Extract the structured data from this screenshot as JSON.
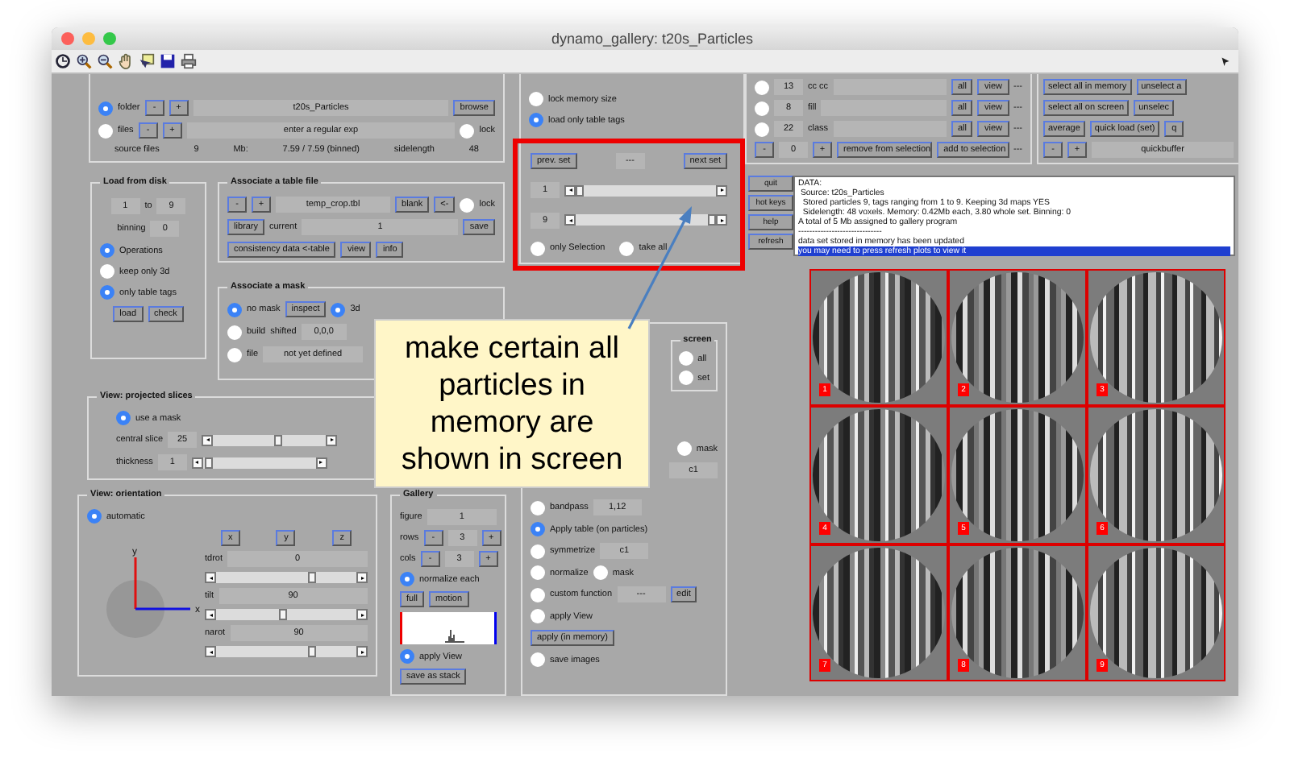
{
  "window": {
    "title": "dynamo_gallery: t20s_Particles"
  },
  "panels": [
    {
      "kind": "group",
      "rows": [
        {
          "items": [
            {
              "kind": "radio",
              "label": "folder",
              "selected": true
            },
            {
              "kind": "button",
              "label": "-"
            },
            {
              "kind": "button",
              "label": "+"
            },
            {
              "kind": "field",
              "value": "t20s_Particles"
            },
            {
              "kind": "button",
              "label": "browse"
            }
          ]
        },
        {
          "items": [
            {
              "kind": "radio",
              "label": "files",
              "selected": false
            },
            {
              "kind": "button",
              "label": "-"
            },
            {
              "kind": "button",
              "label": "+"
            },
            {
              "kind": "field",
              "value": "enter a regular exp"
            },
            {
              "kind": "radio",
              "label": "lock",
              "selected": false
            }
          ]
        },
        {
          "items": [
            {
              "kind": "label",
              "text": "source files"
            },
            {
              "kind": "label",
              "text": "9"
            },
            {
              "kind": "label",
              "text": "Mb:"
            },
            {
              "kind": "label",
              "text": "7.59 / 7.59 (binned)"
            },
            {
              "kind": "label",
              "text": "sidelength"
            },
            {
              "kind": "label",
              "text": "48"
            }
          ]
        }
      ]
    },
    {
      "kind": "group",
      "rows": [
        {
          "items": [
            {
              "kind": "radio",
              "label": "lock memory size",
              "selected": false
            }
          ]
        },
        {
          "items": [
            {
              "kind": "radio",
              "label": "load only table tags",
              "selected": true
            }
          ]
        }
      ]
    },
    {
      "kind": "group",
      "rows": [
        {
          "items": [
            {
              "kind": "radio",
              "selected": false
            },
            {
              "kind": "field",
              "value": "13"
            },
            {
              "kind": "label",
              "text": "cc cc"
            },
            {
              "kind": "field"
            },
            {
              "kind": "button",
              "label": "all"
            },
            {
              "kind": "button",
              "label": "view"
            },
            {
              "kind": "label",
              "text": "---"
            }
          ]
        },
        {
          "items": [
            {
              "kind": "radio",
              "selected": false
            },
            {
              "kind": "field",
              "value": "8"
            },
            {
              "kind": "label",
              "text": "fill"
            },
            {
              "kind": "field"
            },
            {
              "kind": "button",
              "label": "all"
            },
            {
              "kind": "button",
              "label": "view"
            },
            {
              "kind": "label",
              "text": "---"
            }
          ]
        },
        {
          "items": [
            {
              "kind": "radio",
              "selected": false
            },
            {
              "kind": "field",
              "value": "22"
            },
            {
              "kind": "label",
              "text": "class"
            },
            {
              "kind": "field"
            },
            {
              "kind": "button",
              "label": "all"
            },
            {
              "kind": "button",
              "label": "view"
            },
            {
              "kind": "label",
              "text": "---"
            }
          ]
        },
        {
          "items": [
            {
              "kind": "button",
              "label": "-"
            },
            {
              "kind": "field",
              "value": "0"
            },
            {
              "kind": "button",
              "label": "+"
            },
            {
              "kind": "button",
              "label": "remove from selection"
            },
            {
              "kind": "button",
              "label": "add to selection"
            },
            {
              "kind": "label",
              "text": "---"
            }
          ]
        }
      ]
    },
    {
      "kind": "group",
      "rows": [
        {
          "items": [
            {
              "kind": "button",
              "label": "select all in memory"
            },
            {
              "kind": "button",
              "label": "unselect a"
            }
          ]
        },
        {
          "items": [
            {
              "kind": "button",
              "label": "select all on screen"
            },
            {
              "kind": "button",
              "label": "unselec"
            }
          ]
        },
        {
          "items": [
            {
              "kind": "button",
              "label": "average"
            },
            {
              "kind": "button",
              "label": "quick load (set)"
            },
            {
              "kind": "button",
              "label": "q"
            }
          ]
        },
        {
          "items": [
            {
              "kind": "button",
              "label": "-"
            },
            {
              "kind": "button",
              "label": "+"
            },
            {
              "kind": "field",
              "value": "quickbuffer"
            }
          ]
        }
      ]
    },
    {
      "kind": "highlight",
      "rows": [
        {
          "items": [
            {
              "kind": "button",
              "label": "prev. set"
            },
            {
              "kind": "field",
              "value": "---"
            },
            {
              "kind": "button",
              "label": "next set"
            }
          ]
        },
        {
          "items": [
            {
              "kind": "field",
              "value": "1"
            },
            {
              "kind": "slider",
              "level": 0.0
            }
          ]
        },
        {
          "items": [
            {
              "kind": "field",
              "value": "9"
            },
            {
              "kind": "slider",
              "level": 1.0
            }
          ]
        },
        {
          "items": [
            {
              "kind": "radio",
              "label": "only Selection",
              "selected": false
            },
            {
              "kind": "radio",
              "label": "take all",
              "selected": false
            }
          ]
        }
      ]
    },
    {
      "kind": "bare",
      "rows": [
        {
          "items": [
            {
              "kind": "button",
              "label": "quit"
            }
          ]
        },
        {
          "items": [
            {
              "kind": "button",
              "label": "hot keys"
            }
          ]
        },
        {
          "items": [
            {
              "kind": "button",
              "label": "help"
            }
          ]
        },
        {
          "items": [
            {
              "kind": "button",
              "label": "refresh"
            }
          ]
        }
      ]
    },
    {
      "kind": "log",
      "lines": [
        {
          "text": "DATA:",
          "selected": false
        },
        {
          "text": " Source: t20s_Particles",
          "selected": false
        },
        {
          "text": "  Stored particles 9, tags ranging from 1 to 9. Keeping 3d maps YES",
          "selected": false
        },
        {
          "text": "  Sidelength: 48 voxels. Memory: 0.42Mb each, 3.80 whole set. Binning: 0",
          "selected": false
        },
        {
          "text": "A total of 5 Mb assigned to gallery program",
          "selected": false
        },
        {
          "text": "------------------------------",
          "selected": false
        },
        {
          "text": "data set stored in memory has been updated",
          "selected": false
        },
        {
          "text": "you may need to press refresh plots to view it",
          "selected": true
        }
      ]
    },
    {
      "kind": "tiles",
      "tiles": [
        "1",
        "2",
        "3",
        "4",
        "5",
        "6",
        "7",
        "8",
        "9"
      ]
    },
    {
      "kind": "group",
      "title": "Load from disk",
      "rows": [
        {
          "items": [
            {
              "kind": "field",
              "value": "1"
            },
            {
              "kind": "label",
              "text": "to"
            },
            {
              "kind": "field",
              "value": "9"
            }
          ]
        },
        {
          "items": [
            {
              "kind": "label",
              "text": "binning"
            },
            {
              "kind": "field",
              "value": "0"
            }
          ]
        },
        {
          "items": [
            {
              "kind": "radio",
              "label": "Operations",
              "selected": true
            }
          ]
        },
        {
          "items": [
            {
              "kind": "radio",
              "label": "keep only 3d",
              "selected": false
            }
          ]
        },
        {
          "items": [
            {
              "kind": "radio",
              "label": "only table tags",
              "selected": true
            }
          ]
        },
        {
          "items": [
            {
              "kind": "button",
              "label": "load"
            },
            {
              "kind": "button",
              "label": "check"
            }
          ]
        }
      ]
    },
    {
      "kind": "group",
      "title": "Associate a table file",
      "rows": [
        {
          "items": [
            {
              "kind": "button",
              "label": "-"
            },
            {
              "kind": "button",
              "label": "+"
            },
            {
              "kind": "field",
              "value": "temp_crop.tbl"
            },
            {
              "kind": "button",
              "label": "blank"
            },
            {
              "kind": "button",
              "label": "<-"
            },
            {
              "kind": "radio",
              "label": "lock",
              "selected": false
            }
          ]
        },
        {
          "items": [
            {
              "kind": "button",
              "label": "library"
            },
            {
              "kind": "label",
              "text": "current"
            },
            {
              "kind": "field",
              "value": "1"
            },
            {
              "kind": "button",
              "label": "save"
            }
          ]
        },
        {
          "items": [
            {
              "kind": "button",
              "label": "consistency data <-table"
            },
            {
              "kind": "button",
              "label": "view"
            },
            {
              "kind": "button",
              "label": "info"
            }
          ]
        }
      ]
    },
    {
      "kind": "group",
      "title": "Associate a mask",
      "rows": [
        {
          "items": [
            {
              "kind": "radio",
              "label": "no mask",
              "selected": true
            },
            {
              "kind": "button",
              "label": "inspect"
            },
            {
              "kind": "radio",
              "label": "3d",
              "selected": true
            }
          ]
        },
        {
          "items": [
            {
              "kind": "radio",
              "label": "build",
              "selected": false
            },
            {
              "kind": "label",
              "text": "shifted"
            },
            {
              "kind": "field",
              "value": "0,0,0"
            }
          ]
        },
        {
          "items": [
            {
              "kind": "radio",
              "label": "file",
              "selected": false
            },
            {
              "kind": "field",
              "value": "not yet defined"
            }
          ]
        }
      ]
    },
    {
      "kind": "group",
      "title": "View: projected slices",
      "rows": [
        {
          "items": [
            {
              "kind": "radio",
              "label": "use a mask",
              "selected": true
            }
          ]
        },
        {
          "items": [
            {
              "kind": "label",
              "text": "central slice"
            },
            {
              "kind": "field",
              "value": "25"
            },
            {
              "kind": "slider",
              "level": 0.58
            }
          ]
        },
        {
          "items": [
            {
              "kind": "label",
              "text": "thickness"
            },
            {
              "kind": "field",
              "value": "1"
            },
            {
              "kind": "slider",
              "level": 0.02
            }
          ]
        }
      ]
    },
    {
      "kind": "group",
      "title": "View: orientation",
      "rows": [
        {
          "items": [
            {
              "kind": "radio",
              "label": "automatic",
              "selected": true
            }
          ]
        },
        {
          "items": [
            {
              "kind": "axes",
              "labels": [
                "y",
                "x"
              ]
            },
            {
              "kind": "stack",
              "rows": [
                {
                  "items": [
                    {
                      "kind": "button",
                      "label": "x"
                    },
                    {
                      "kind": "button",
                      "label": "y"
                    },
                    {
                      "kind": "button",
                      "label": "z"
                    }
                  ]
                },
                {
                  "items": [
                    {
                      "kind": "label",
                      "text": "tdrot"
                    },
                    {
                      "kind": "field",
                      "value": "0"
                    }
                  ]
                },
                {
                  "items": [
                    {
                      "kind": "slider",
                      "level": 0.7
                    }
                  ]
                },
                {
                  "items": [
                    {
                      "kind": "label",
                      "text": "tilt"
                    },
                    {
                      "kind": "field",
                      "value": "90"
                    }
                  ]
                },
                {
                  "items": [
                    {
                      "kind": "slider",
                      "level": 0.47
                    }
                  ]
                },
                {
                  "items": [
                    {
                      "kind": "label",
                      "text": "narot"
                    },
                    {
                      "kind": "field",
                      "value": "90"
                    }
                  ]
                },
                {
                  "items": [
                    {
                      "kind": "slider",
                      "level": 0.7
                    }
                  ]
                }
              ]
            }
          ]
        }
      ]
    },
    {
      "kind": "group",
      "title": "Gallery",
      "rows": [
        {
          "items": [
            {
              "kind": "label",
              "text": "figure"
            },
            {
              "kind": "field",
              "value": "1"
            }
          ]
        },
        {
          "items": [
            {
              "kind": "label",
              "text": "rows"
            },
            {
              "kind": "button",
              "label": "-"
            },
            {
              "kind": "field",
              "value": "3"
            },
            {
              "kind": "button",
              "label": "+"
            }
          ]
        },
        {
          "items": [
            {
              "kind": "label",
              "text": "cols"
            },
            {
              "kind": "button",
              "label": "-"
            },
            {
              "kind": "field",
              "value": "3"
            },
            {
              "kind": "button",
              "label": "+"
            }
          ]
        },
        {
          "items": [
            {
              "kind": "radio",
              "label": "normalize each",
              "selected": true
            }
          ]
        },
        {
          "items": [
            {
              "kind": "button",
              "label": "full"
            },
            {
              "kind": "button",
              "label": "motion"
            }
          ]
        },
        {
          "items": [
            {
              "kind": "histogram"
            }
          ]
        },
        {
          "items": [
            {
              "kind": "radio",
              "label": "apply View",
              "selected": true
            }
          ]
        },
        {
          "items": [
            {
              "kind": "button",
              "label": "save as stack"
            }
          ]
        }
      ]
    },
    {
      "kind": "group",
      "rows": [
        {
          "items": [
            {
              "kind": "group",
              "title": "screen",
              "rows": [
                {
                  "items": [
                    {
                      "kind": "radio",
                      "label": "all",
                      "selected": false
                    }
                  ]
                },
                {
                  "items": [
                    {
                      "kind": "radio",
                      "label": "set",
                      "selected": false
                    }
                  ]
                }
              ]
            }
          ]
        },
        {
          "items": [
            {
              "kind": "radio",
              "label": "mask",
              "selected": false
            }
          ]
        },
        {
          "items": [
            {
              "kind": "field",
              "value": "c1"
            }
          ]
        },
        {
          "items": [
            {
              "kind": "radio",
              "label": "bandpass",
              "selected": false
            },
            {
              "kind": "field",
              "value": "1,12"
            }
          ]
        },
        {
          "items": [
            {
              "kind": "radio",
              "label": "Apply table (on particles)",
              "selected": true
            }
          ]
        },
        {
          "items": [
            {
              "kind": "radio",
              "label": "symmetrize",
              "selected": false
            },
            {
              "kind": "field",
              "value": "c1"
            }
          ]
        },
        {
          "items": [
            {
              "kind": "radio",
              "label": "normalize",
              "selected": false
            },
            {
              "kind": "radio",
              "label": "mask",
              "selected": false
            }
          ]
        },
        {
          "items": [
            {
              "kind": "radio",
              "label": "custom function",
              "selected": false
            },
            {
              "kind": "field",
              "value": "---"
            },
            {
              "kind": "button",
              "label": "edit"
            }
          ]
        },
        {
          "items": [
            {
              "kind": "radio",
              "label": "apply View",
              "selected": false
            }
          ]
        },
        {
          "items": [
            {
              "kind": "button",
              "label": "apply (in memory)"
            }
          ]
        },
        {
          "items": [
            {
              "kind": "radio",
              "label": "save images",
              "selected": false
            }
          ]
        }
      ]
    }
  ],
  "callout": {
    "text": "make certain all particles in memory are shown in screen"
  }
}
